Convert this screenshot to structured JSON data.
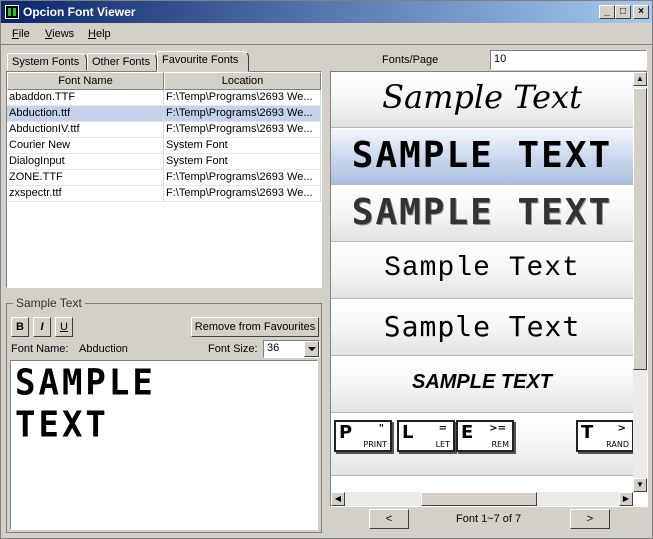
{
  "window": {
    "title": "Opcion Font Viewer"
  },
  "menu": [
    "File",
    "Views",
    "Help"
  ],
  "tabs": [
    "System Fonts",
    "Other Fonts",
    "Favourite Fonts"
  ],
  "table": {
    "columns": [
      "Font Name",
      "Location"
    ],
    "rows": [
      {
        "name": "abaddon.TTF",
        "location": "F:\\Temp\\Programs\\2693 We..."
      },
      {
        "name": "Abduction.ttf",
        "location": "F:\\Temp\\Programs\\2693 We..."
      },
      {
        "name": "AbductionIV.ttf",
        "location": "F:\\Temp\\Programs\\2693 We..."
      },
      {
        "name": "Courier New",
        "location": "System Font"
      },
      {
        "name": "DialogInput",
        "location": "System Font"
      },
      {
        "name": "ZONE.TTF",
        "location": "F:\\Temp\\Programs\\2693 We..."
      },
      {
        "name": "zxspectr.ttf",
        "location": "F:\\Temp\\Programs\\2693 We..."
      }
    ]
  },
  "sample": {
    "group_label": "Sample Text",
    "bold": "B",
    "italic": "I",
    "underline": "U",
    "remove_button": "Remove from Favourites",
    "font_name_label": "Font Name:",
    "font_name_value": "Abduction",
    "font_size_label": "Font Size:",
    "font_size_value": "36",
    "preview_lines": [
      "SAMPLE",
      "TEXT"
    ]
  },
  "right": {
    "fonts_per_page_label": "Fonts/Page",
    "fonts_per_page_value": "10",
    "samples": [
      "Sample Text",
      "SAMPLE TEXT",
      "SAMPLE TEXT",
      "Sample Text",
      "Sample Text",
      "SAMPLE TEXT"
    ],
    "zx_keys": [
      {
        "main": "P",
        "sup": "\"",
        "sub": "PRINT"
      },
      {
        "main": "L",
        "sup": "=",
        "sub": "LET"
      },
      {
        "main": "E",
        "sup": ">=",
        "sub": "REM"
      },
      {
        "main": "T",
        "sup": ">",
        "sub": "RAND"
      }
    ],
    "prev_button": "<",
    "next_button": ">",
    "page_status": "Font 1~7 of 7"
  }
}
